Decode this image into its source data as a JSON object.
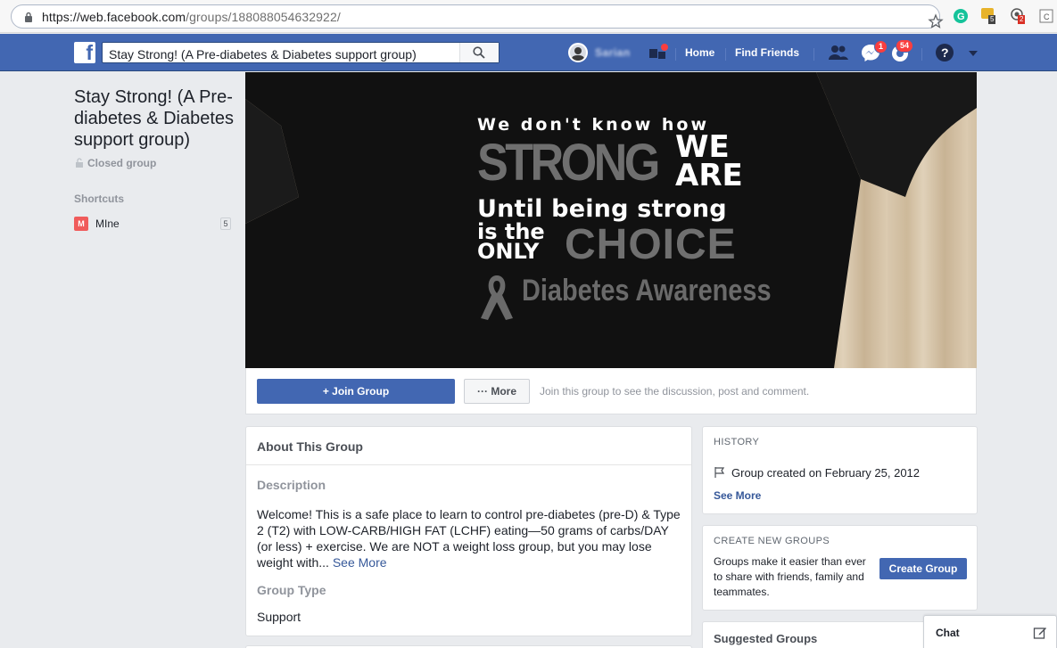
{
  "browser": {
    "url_host": "https://web.facebook.com",
    "url_path": "/groups/188088054632922/",
    "ext_badges": [
      "5",
      "2"
    ]
  },
  "header": {
    "search_value": "Stay Strong! (A Pre-diabetes & Diabetes support group)",
    "user_name": "Sarian",
    "home": "Home",
    "find_friends": "Find Friends",
    "messages_badge": "1",
    "notifications_badge": "54"
  },
  "left": {
    "group_title": "Stay Strong! (A Pre-diabetes & Diabetes support group)",
    "privacy": "Closed group",
    "shortcuts_heading": "Shortcuts",
    "shortcut_icon": "M",
    "shortcut_label": "MIne",
    "shortcut_count": "5"
  },
  "cover": {
    "line1": "We don't know how",
    "strong": "STRONG",
    "we": "WE",
    "are": "ARE",
    "until": "Until being strong",
    "is_the": "is the",
    "only": "ONLY",
    "choice": "CHOICE",
    "awareness": "Diabetes Awareness"
  },
  "actions": {
    "join": "+ Join Group",
    "more": "··· More",
    "hint": "Join this group to see the discussion, post and comment."
  },
  "about": {
    "heading": "About This Group",
    "description_label": "Description",
    "description": "Welcome! This is a safe place to learn to control pre-diabetes (pre-D) & Type 2 (T2) with LOW-CARB/HIGH FAT (LCHF) eating—50 grams of carbs/DAY (or less) + exercise. We are NOT a weight loss group, but you may lose weight with...",
    "see_more": "See More",
    "group_type_label": "Group Type",
    "group_type": "Support"
  },
  "history": {
    "caption": "HISTORY",
    "created": "Group created on February 25, 2012",
    "see_more": "See More"
  },
  "create": {
    "caption": "CREATE NEW GROUPS",
    "text": "Groups make it easier than ever to share with friends, family and teammates.",
    "button": "Create Group"
  },
  "suggested": {
    "heading": "Suggested Groups"
  },
  "chat": {
    "label": "Chat"
  },
  "colors": {
    "fb_blue": "#4267b2",
    "link": "#365899",
    "badge_red": "#fa3e3e",
    "page_bg": "#e9ebee"
  },
  "icons": [
    "lock-icon",
    "star-icon",
    "grammarly-icon",
    "extension-icon",
    "facebook-logo-icon",
    "search-icon",
    "friend-requests-icon",
    "messenger-icon",
    "notifications-icon",
    "help-icon",
    "dropdown-icon",
    "padlock-icon",
    "flag-icon",
    "compose-icon",
    "ribbon-icon"
  ]
}
